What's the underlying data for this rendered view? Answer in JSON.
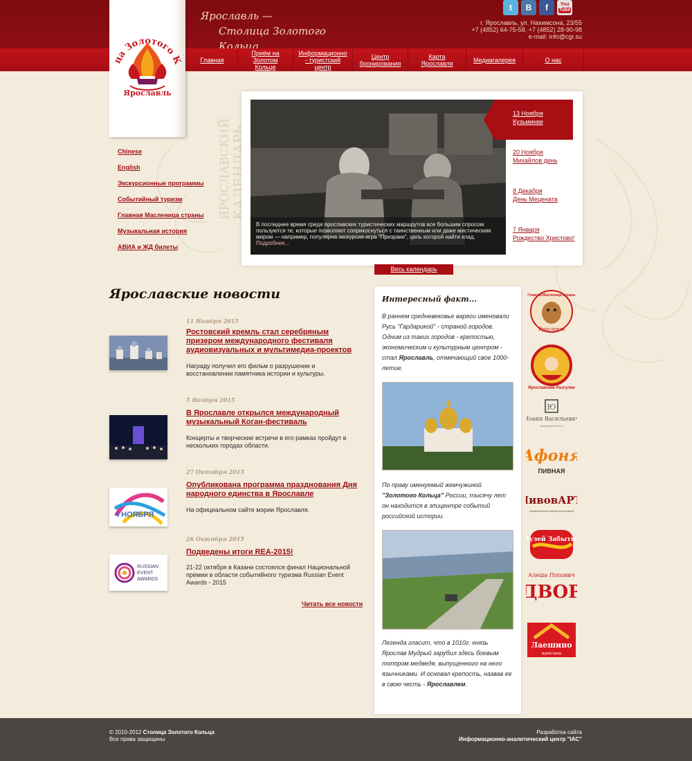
{
  "header": {
    "slogan_line1": "Ярославль —",
    "slogan_line2": "Столица Золотого Кольца",
    "social": {
      "tw": "t",
      "vk": "B",
      "fb": "f",
      "yt_top": "You",
      "yt_bottom": "Tube"
    },
    "address": "г. Ярославль, ул. Нахимсона, 23/55",
    "phones": "+7 (4852) 64-75-58, +7 (4852) 28-90-98",
    "email_label": "e-mail:",
    "email": "info@cgr.su"
  },
  "logo": {
    "arc_text": "Столица Золотого Кольца",
    "city": "Ярославль"
  },
  "nav": [
    {
      "label": "Главная"
    },
    {
      "label": "Приём на Золотом Кольце"
    },
    {
      "label": "Информационно - туристский центр"
    },
    {
      "label": "Центр бронирования"
    },
    {
      "label": "Карта Ярославля"
    },
    {
      "label": "Медиагалерея"
    },
    {
      "label": "О нас"
    }
  ],
  "sidebar": [
    {
      "label": "Chinese"
    },
    {
      "label": "English"
    },
    {
      "label": "Экскурсионные программы"
    },
    {
      "label": "Событийный туризм"
    },
    {
      "label": "Главная Масленица страны"
    },
    {
      "label": "Музыкальная история"
    },
    {
      "label": "АВИА и ЖД билеты"
    }
  ],
  "calendar": {
    "vertical_line1": "ЯРОСЛАВСКИЙ",
    "vertical_line2": "КАЛЕНДАРЬ",
    "caption": "В последнее время среди ярославских туристических маршрутов все большим спросом пользуются те, которые позволяют соприкоснуться с таинственным или даже мистическим миром — например, популярна экскурсия-игра \"Призраки\", цель которой найти клад.",
    "more": "Подробнее...",
    "events": [
      {
        "date": "13 Ноября",
        "name": "Кузьминки"
      },
      {
        "date": "20 Ноября",
        "name": "Михайлов день"
      },
      {
        "date": "8 Декабря",
        "name": "День Мецената"
      },
      {
        "date": "7 Января",
        "name": "Рождество Христово!"
      }
    ],
    "all_link": "Весь календарь"
  },
  "news": {
    "title": "Ярославские новости",
    "items": [
      {
        "date": "11 Ноября 2015",
        "headline": "Ростовский кремль стал серебряным призером международного фестиваля аудиовизуальных и мультимедиа-проектов",
        "text": "Награду получил его фильм о разрушении и восстановлении памятника истории и культуры."
      },
      {
        "date": "5 Ноября 2015",
        "headline": "В Ярославле открылся международный музыкальный Коган-фестиваль",
        "text": "Концерты и творческие встречи в его рамках пройдут в нескольких городах области."
      },
      {
        "date": "27 Октября 2015",
        "headline": "Опубликована программа празднования Дня народного единства в Ярославле",
        "text": "На официальном сайте мэрии Ярославля."
      },
      {
        "date": "26 Октября 2015",
        "headline": "Подведены итоги REA-2015!",
        "text": "21-22 октября в Казани состоялся финал Национальной премии в области событийного туризма Russian Event Awards - 2015"
      }
    ],
    "thumb_unity_text": "4 НОЯБРЯ",
    "thumb_rea_text": [
      "RUSSIAN",
      "EVENT",
      "AWARDS"
    ],
    "all_link": "Читать все новости"
  },
  "fact": {
    "title": "Интересный факт...",
    "p1_a": "В раннем средневековье варяги именовали Русь \"Гардарикой\" - страной городов. Одним из таких городов - крепостью, экономическим и культурным центром - стал ",
    "p1_b": "Ярославль",
    "p1_c": ", отмечающий свое 1000-летие.",
    "p2_a": "По праву именуемый жемчужиной ",
    "p2_b": "\"Золотого Кольца\"",
    "p2_c": " России, тысячу лет он находится в эпицентре событий российской истории.",
    "p3_a": "Легенда гласит, что в 1010г. князь Ярослав Мудрый зарубил здесь боевым топором медведя, выпущенного на него язычниками. И основал крепость, назвав ее в свою честь - ",
    "p3_b": "Ярославлем",
    "p3_c": "."
  },
  "partners": [
    {
      "name": "Главная Масленица страны",
      "sub": "Ярославль"
    },
    {
      "name": "Ярославские Разгуляи"
    },
    {
      "name": "Иоанн Васильевич",
      "sub": "фамильное место"
    },
    {
      "name": "Афоня",
      "sub": "ПИВНАЯ"
    },
    {
      "name": "ПивовАРЪ",
      "sub": "национальная пивная ресторация"
    },
    {
      "name": "Музей Забытых"
    },
    {
      "name": "Алеша Попович",
      "sub": "ДВОР"
    },
    {
      "name": "Лаешино",
      "sub": "музей-театр"
    }
  ],
  "footer": {
    "copyright_a": "© 2010-2012 ",
    "copyright_b": "Столица Золотого Кольца",
    "rights": "Все права защищены",
    "dev": "Разработка сайта",
    "dev_org": "Информационно-аналитический центр \"IAC\""
  },
  "colors": {
    "header_dark": "#8f0f13",
    "nav_red": "#c4121a",
    "link_red": "#9b0c12",
    "background": "#f3ebdc",
    "footer": "#4a4641"
  }
}
